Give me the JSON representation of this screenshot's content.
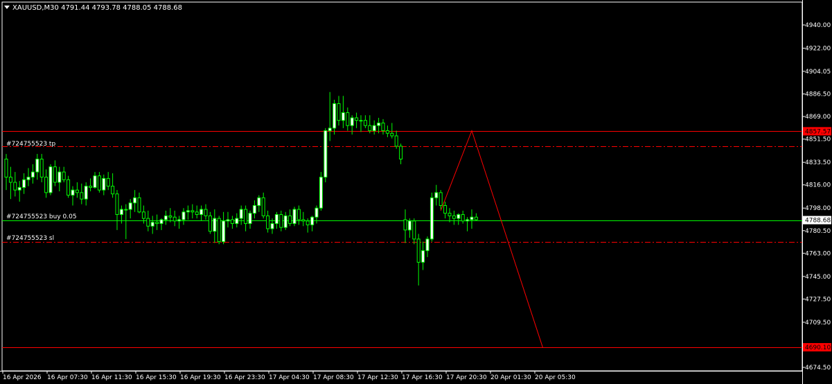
{
  "header": {
    "symbol_line": "XAUUSD,M30  4791.44 4793.78 4788.05 4788.68"
  },
  "colors": {
    "background": "#000000",
    "candle_up": "#ffffff",
    "candle_down": "#000000",
    "wick": "#00ff00",
    "order_line": "#ff0000",
    "price_line": "#00ff00",
    "axis_text": "#ffffff"
  },
  "orders": {
    "tp_label": "#724755523 tp",
    "buy_label": "#724755523 buy 0.05",
    "sl_label": "#724755523 sl"
  },
  "chart_data": {
    "type": "candlestick",
    "symbol": "XAUUSD",
    "timeframe": "M30",
    "ylim": [
      4665,
      4955
    ],
    "y_ticks": [
      "4940.00",
      "4922.00",
      "4904.05",
      "4886.50",
      "4869.00",
      "4851.50",
      "4833.50",
      "4816.00",
      "4798.00",
      "4780.50",
      "4763.00",
      "4745.00",
      "4727.50",
      "4709.50",
      "4674.50"
    ],
    "x_ticks": [
      "16 Apr 2026",
      "16 Apr 07:30",
      "16 Apr 11:30",
      "16 Apr 15:30",
      "16 Apr 19:30",
      "16 Apr 23:30",
      "17 Apr 04:30",
      "17 Apr 08:30",
      "17 Apr 12:30",
      "17 Apr 16:30",
      "17 Apr 20:30",
      "20 Apr 01:30",
      "20 Apr 05:30"
    ],
    "current_price": "4788.68",
    "levels": [
      {
        "name": "horizontal-line-upper",
        "price": "4857.57"
      },
      {
        "name": "take-profit",
        "price": 4846
      },
      {
        "name": "buy-entry",
        "price": 4788.68
      },
      {
        "name": "stop-loss",
        "price": 4772
      },
      {
        "name": "horizontal-line-lower",
        "price": "4690.10"
      }
    ],
    "projection": [
      {
        "bar": 98,
        "price": 4796
      },
      {
        "bar": 105,
        "price": 4858
      },
      {
        "bar": 121,
        "price": 4690
      }
    ],
    "candles": [
      [
        4836,
        4840,
        4812,
        4822
      ],
      [
        4822,
        4830,
        4805,
        4818
      ],
      [
        4818,
        4826,
        4807,
        4812
      ],
      [
        4812,
        4819,
        4803,
        4814
      ],
      [
        4814,
        4825,
        4809,
        4820
      ],
      [
        4820,
        4829,
        4815,
        4822
      ],
      [
        4822,
        4832,
        4817,
        4826
      ],
      [
        4826,
        4840,
        4820,
        4836
      ],
      [
        4836,
        4840,
        4818,
        4822
      ],
      [
        4822,
        4828,
        4806,
        4810
      ],
      [
        4810,
        4832,
        4808,
        4830
      ],
      [
        4830,
        4835,
        4815,
        4818
      ],
      [
        4818,
        4830,
        4811,
        4826
      ],
      [
        4826,
        4830,
        4818,
        4820
      ],
      [
        4820,
        4823,
        4806,
        4808
      ],
      [
        4808,
        4815,
        4800,
        4812
      ],
      [
        4812,
        4818,
        4806,
        4810
      ],
      [
        4810,
        4817,
        4801,
        4805
      ],
      [
        4805,
        4818,
        4800,
        4815
      ],
      [
        4815,
        4821,
        4811,
        4814
      ],
      [
        4814,
        4826,
        4813,
        4823
      ],
      [
        4823,
        4826,
        4810,
        4812
      ],
      [
        4812,
        4824,
        4808,
        4821
      ],
      [
        4821,
        4826,
        4812,
        4815
      ],
      [
        4815,
        4825,
        4806,
        4809
      ],
      [
        4809,
        4812,
        4781,
        4793
      ],
      [
        4793,
        4800,
        4786,
        4797
      ],
      [
        4797,
        4801,
        4774,
        4797
      ],
      [
        4797,
        4805,
        4790,
        4802
      ],
      [
        4802,
        4812,
        4795,
        4806
      ],
      [
        4806,
        4810,
        4794,
        4795
      ],
      [
        4795,
        4800,
        4786,
        4790
      ],
      [
        4790,
        4796,
        4780,
        4784
      ],
      [
        4784,
        4792,
        4778,
        4787
      ],
      [
        4787,
        4793,
        4781,
        4786
      ],
      [
        4786,
        4790,
        4781,
        4789
      ],
      [
        4789,
        4796,
        4785,
        4792
      ],
      [
        4792,
        4798,
        4787,
        4791
      ],
      [
        4791,
        4796,
        4784,
        4788
      ],
      [
        4788,
        4792,
        4782,
        4789
      ],
      [
        4789,
        4798,
        4785,
        4795
      ],
      [
        4795,
        4800,
        4789,
        4796
      ],
      [
        4796,
        4801,
        4790,
        4795
      ],
      [
        4795,
        4800,
        4790,
        4793
      ],
      [
        4793,
        4800,
        4788,
        4797
      ],
      [
        4797,
        4801,
        4789,
        4792
      ],
      [
        4792,
        4795,
        4778,
        4780
      ],
      [
        4780,
        4797,
        4771,
        4790
      ],
      [
        4790,
        4792,
        4770,
        4772
      ],
      [
        4772,
        4795,
        4770,
        4788
      ],
      [
        4788,
        4795,
        4783,
        4789
      ],
      [
        4789,
        4792,
        4782,
        4786
      ],
      [
        4786,
        4794,
        4783,
        4790
      ],
      [
        4790,
        4800,
        4785,
        4797
      ],
      [
        4797,
        4800,
        4780,
        4786
      ],
      [
        4786,
        4796,
        4782,
        4794
      ],
      [
        4794,
        4804,
        4790,
        4800
      ],
      [
        4800,
        4808,
        4795,
        4806
      ],
      [
        4806,
        4810,
        4790,
        4792
      ],
      [
        4792,
        4796,
        4779,
        4782
      ],
      [
        4782,
        4790,
        4778,
        4786
      ],
      [
        4786,
        4795,
        4782,
        4793
      ],
      [
        4793,
        4796,
        4780,
        4783
      ],
      [
        4783,
        4795,
        4781,
        4792
      ],
      [
        4792,
        4797,
        4784,
        4786
      ],
      [
        4786,
        4799,
        4784,
        4797
      ],
      [
        4797,
        4800,
        4785,
        4789
      ],
      [
        4789,
        4795,
        4784,
        4788
      ],
      [
        4788,
        4790,
        4779,
        4785
      ],
      [
        4785,
        4792,
        4780,
        4791
      ],
      [
        4791,
        4800,
        4786,
        4798
      ],
      [
        4798,
        4826,
        4796,
        4822
      ],
      [
        4822,
        4860,
        4818,
        4858
      ],
      [
        4858,
        4888,
        4850,
        4860
      ],
      [
        4860,
        4882,
        4855,
        4879
      ],
      [
        4879,
        4885,
        4862,
        4866
      ],
      [
        4866,
        4885,
        4860,
        4872
      ],
      [
        4872,
        4876,
        4858,
        4862
      ],
      [
        4862,
        4870,
        4855,
        4868
      ],
      [
        4868,
        4872,
        4860,
        4866
      ],
      [
        4866,
        4870,
        4857,
        4866
      ],
      [
        4866,
        4870,
        4860,
        4862
      ],
      [
        4862,
        4870,
        4856,
        4858
      ],
      [
        4858,
        4866,
        4855,
        4862
      ],
      [
        4862,
        4868,
        4856,
        4864
      ],
      [
        4864,
        4867,
        4855,
        4858
      ],
      [
        4858,
        4862,
        4853,
        4856
      ],
      [
        4856,
        4864,
        4852,
        4854
      ],
      [
        4854,
        4858,
        4844,
        4846
      ],
      [
        4846,
        4848,
        4832,
        4836
      ],
      [
        4789,
        4797,
        4771,
        4781
      ],
      [
        4781,
        4790,
        4775,
        4788
      ],
      [
        4788,
        4790,
        4770,
        4774
      ],
      [
        4774,
        4778,
        4738,
        4756
      ],
      [
        4756,
        4772,
        4750,
        4765
      ],
      [
        4765,
        4776,
        4760,
        4774
      ],
      [
        4774,
        4810,
        4772,
        4806
      ],
      [
        4806,
        4816,
        4800,
        4810
      ],
      [
        4810,
        4812,
        4797,
        4800
      ],
      [
        4800,
        4803,
        4790,
        4794
      ],
      [
        4794,
        4798,
        4787,
        4792
      ],
      [
        4792,
        4796,
        4785,
        4790
      ],
      [
        4790,
        4794,
        4785,
        4793
      ],
      [
        4793,
        4796,
        4786,
        4788
      ],
      [
        4788,
        4791,
        4780,
        4789
      ],
      [
        4789,
        4797,
        4782,
        4791
      ],
      [
        4791,
        4794,
        4788,
        4789
      ]
    ]
  }
}
